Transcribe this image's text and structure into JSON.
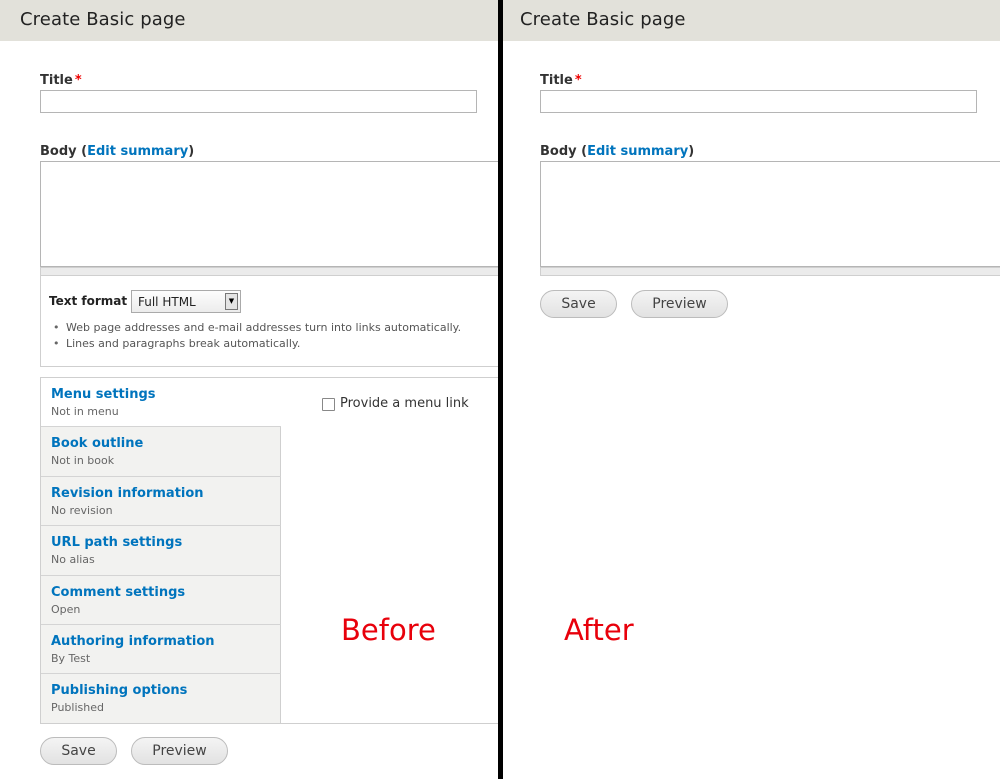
{
  "before": {
    "header_title": "Create Basic page",
    "title_label": "Title",
    "required_mark": "*",
    "body_label": "Body",
    "edit_summary_link": "Edit summary",
    "text_format_label": "Text format",
    "text_format_value": "Full HTML",
    "format_tips": [
      "Web page addresses and e-mail addresses turn into links automatically.",
      "Lines and paragraphs break automatically."
    ],
    "vertical_tabs": [
      {
        "title": "Menu settings",
        "summary": "Not in menu"
      },
      {
        "title": "Book outline",
        "summary": "Not in book"
      },
      {
        "title": "Revision information",
        "summary": "No revision"
      },
      {
        "title": "URL path settings",
        "summary": "No alias"
      },
      {
        "title": "Comment settings",
        "summary": "Open"
      },
      {
        "title": "Authoring information",
        "summary": "By Test"
      },
      {
        "title": "Publishing options",
        "summary": "Published"
      }
    ],
    "menu_link_checkbox_label": "Provide a menu link",
    "save_label": "Save",
    "preview_label": "Preview",
    "caption": "Before"
  },
  "after": {
    "header_title": "Create Basic page",
    "title_label": "Title",
    "required_mark": "*",
    "body_label": "Body",
    "edit_summary_link": "Edit summary",
    "save_label": "Save",
    "preview_label": "Preview",
    "caption": "After"
  },
  "colors": {
    "header_bg": "#e2e1da",
    "link": "#0074bd",
    "required": "#e00000",
    "caption": "#e8000b",
    "divider": "#000000"
  }
}
